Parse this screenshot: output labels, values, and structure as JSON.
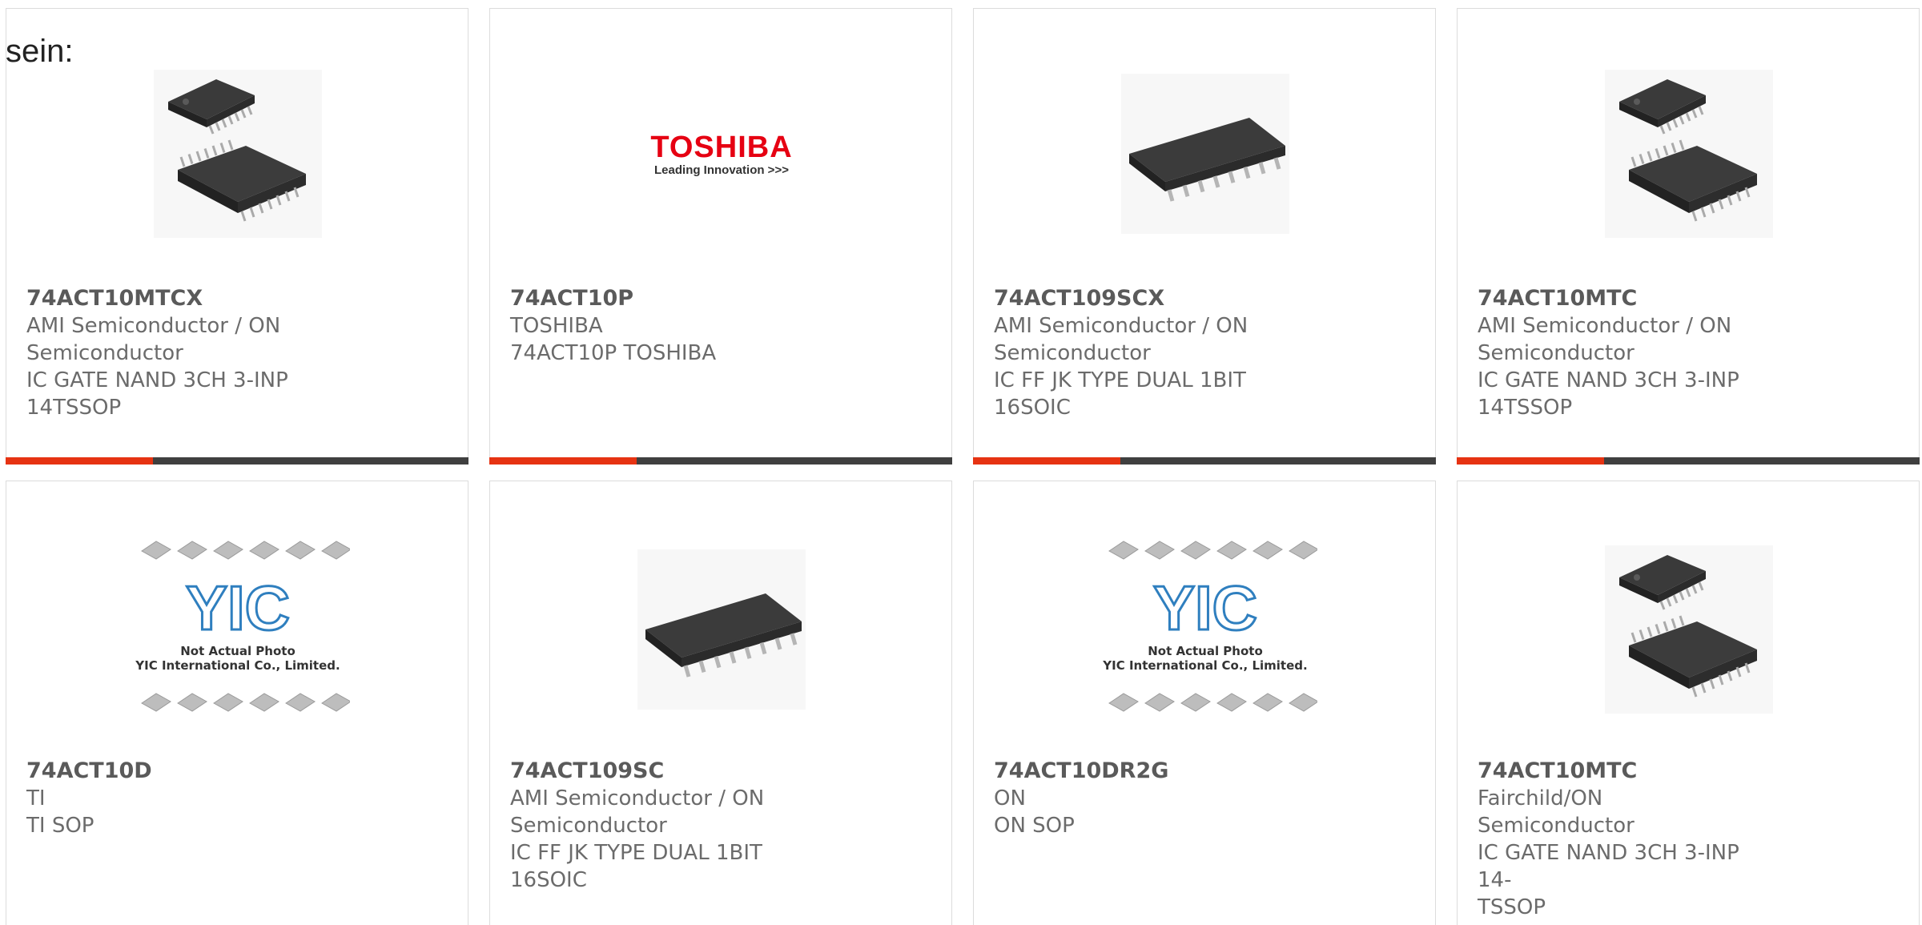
{
  "heading_fragment": "sein:",
  "colors": {
    "accent": "#e63312",
    "bar": "#3f3f3f",
    "text": "#6b6b6b",
    "border": "#dcdcdc"
  },
  "products": [
    {
      "part_number": "74ACT10MTCX",
      "lines": [
        "AMI Semiconductor / ON",
        "Semiconductor",
        "IC GATE NAND 3CH 3-INP",
        "14TSSOP"
      ],
      "image": "tssop-chip-image"
    },
    {
      "part_number": "74ACT10P",
      "lines": [
        "TOSHIBA",
        "74ACT10P TOSHIBA"
      ],
      "image": "toshiba-logo",
      "logo_text": "TOSHIBA",
      "logo_tagline": "Leading Innovation >>>"
    },
    {
      "part_number": "74ACT109SCX",
      "lines": [
        "AMI Semiconductor / ON",
        "Semiconductor",
        "IC FF JK TYPE DUAL 1BIT 16SOIC"
      ],
      "image": "soic-chip-image"
    },
    {
      "part_number": "74ACT10MTC",
      "lines": [
        "AMI Semiconductor / ON",
        "Semiconductor",
        "IC GATE NAND 3CH 3-INP",
        "14TSSOP"
      ],
      "image": "tssop-chip-image"
    },
    {
      "part_number": "74ACT10D",
      "lines": [
        "TI",
        "TI SOP"
      ],
      "image": "yic-placeholder",
      "placeholder_line1": "Not Actual Photo",
      "placeholder_line2": "YIC International Co., Limited."
    },
    {
      "part_number": "74ACT109SC",
      "lines": [
        "AMI Semiconductor / ON",
        "Semiconductor",
        "IC FF JK TYPE DUAL 1BIT 16SOIC"
      ],
      "image": "soic-chip-image"
    },
    {
      "part_number": "74ACT10DR2G",
      "lines": [
        "ON",
        "ON SOP"
      ],
      "image": "yic-placeholder",
      "placeholder_line1": "Not Actual Photo",
      "placeholder_line2": "YIC International Co., Limited."
    },
    {
      "part_number": "74ACT10MTC",
      "lines": [
        "Fairchild/ON Semiconductor",
        "IC GATE NAND 3CH 3-INP 14-",
        "TSSOP"
      ],
      "image": "tssop-chip-image"
    }
  ]
}
